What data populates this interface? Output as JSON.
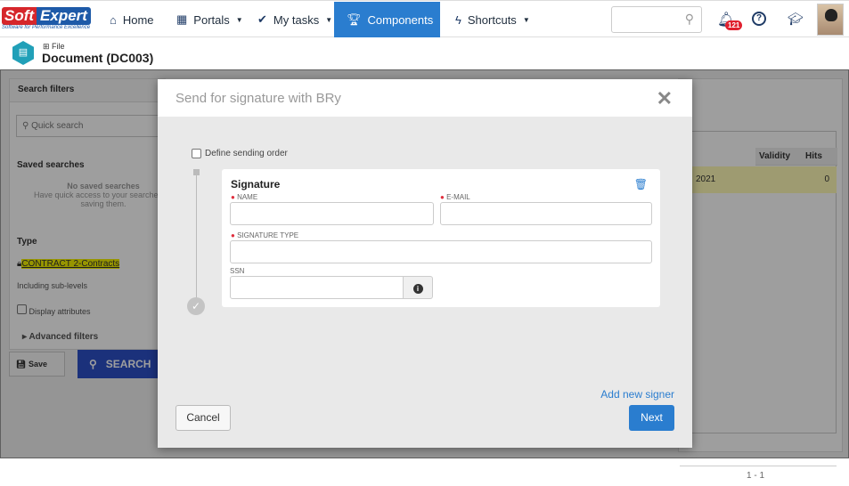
{
  "logo": {
    "word1": "Soft",
    "word2": "Expert",
    "tagline": "Software for Performance Excellence"
  },
  "nav": [
    {
      "label": "Home",
      "icon": "home-icon"
    },
    {
      "label": "Portals",
      "icon": "grid-icon"
    },
    {
      "label": "My tasks",
      "icon": "check-icon"
    },
    {
      "label": "Components",
      "icon": "trophy-icon",
      "active": true
    },
    {
      "label": "Shortcuts",
      "icon": "bolt-icon"
    }
  ],
  "header": {
    "notifications": "121",
    "accent": "#2a7dcf"
  },
  "breadcrumb": {
    "parent": "File",
    "title": "Document (DC003)"
  },
  "filters": {
    "title": "Search filters",
    "quick_search": "Quick search",
    "saved_title": "Saved searches",
    "no_saved": "No saved searches",
    "no_saved_hint": "Have quick access to your searches by saving them.",
    "type_title": "Type",
    "type_value": "CONTRACT 2-Contracts",
    "sub_levels": "Including sub-levels",
    "display_attributes": "Display attributes",
    "advanced": "Advanced filters",
    "save": "Save",
    "search": "SEARCH"
  },
  "table": {
    "columns": [
      "Validity",
      "Hits"
    ],
    "row": {
      "date_fragment": "2021",
      "validity": "",
      "hits": "0"
    },
    "pagination": "1 - 1"
  },
  "modal": {
    "title": "Send for signature with BRy",
    "define_order": "Define sending order",
    "card_title": "Signature",
    "name_label": "NAME",
    "email_label": "E-MAIL",
    "sigtype_label": "SIGNATURE TYPE",
    "ssn_label": "SSN",
    "add_signer": "Add new signer",
    "cancel": "Cancel",
    "next": "Next"
  }
}
